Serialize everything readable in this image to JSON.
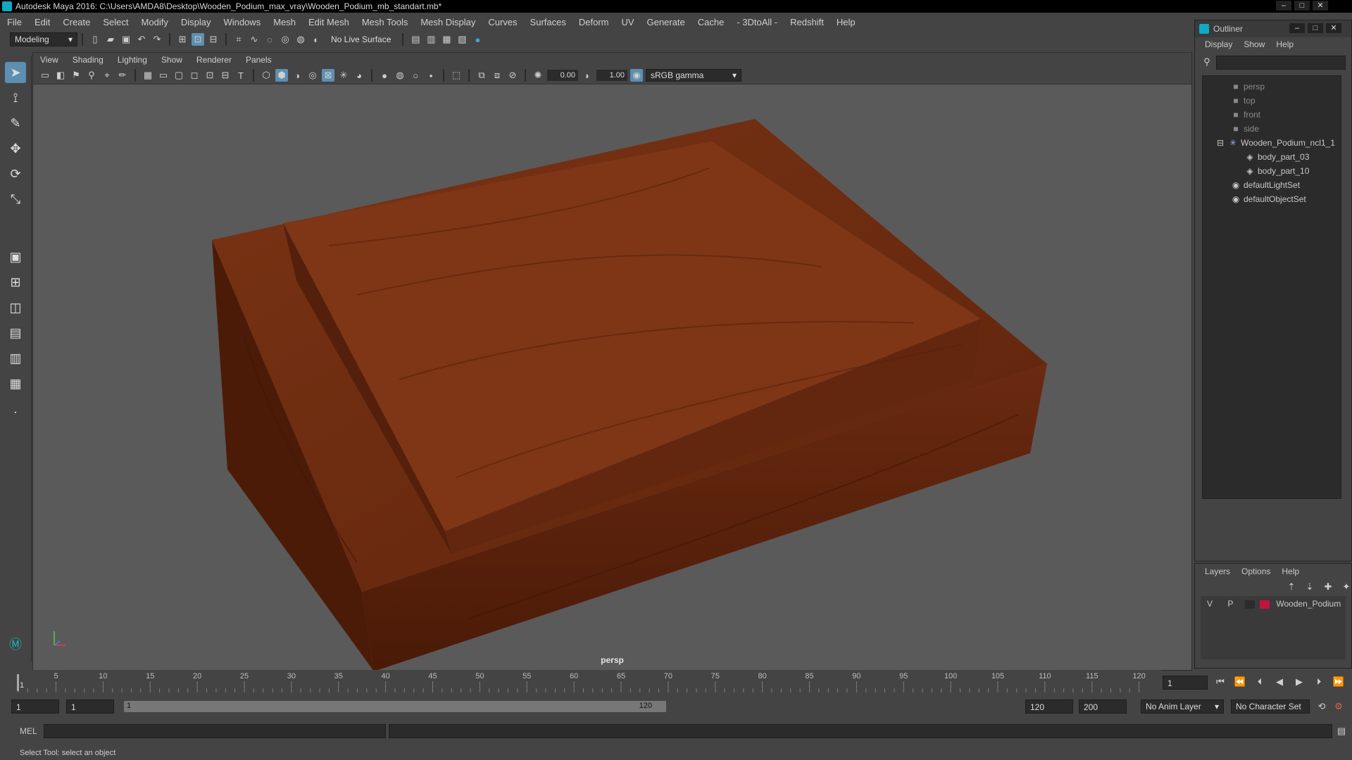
{
  "window": {
    "title": "Autodesk Maya 2016: C:\\Users\\AMDA8\\Desktop\\Wooden_Podium_max_vray\\Wooden_Podium_mb_standart.mb*"
  },
  "menubar": [
    "File",
    "Edit",
    "Create",
    "Select",
    "Modify",
    "Display",
    "Windows",
    "Mesh",
    "Edit Mesh",
    "Mesh Tools",
    "Mesh Display",
    "Curves",
    "Surfaces",
    "Deform",
    "UV",
    "Generate",
    "Cache",
    "- 3DtoAll -",
    "Redshift",
    "Help"
  ],
  "statusline": {
    "mode": "Modeling",
    "live_surface": "No Live Surface"
  },
  "viewport": {
    "menu": [
      "View",
      "Shading",
      "Lighting",
      "Show",
      "Renderer",
      "Panels"
    ],
    "exposure": "0.00",
    "gamma": "1.00",
    "color_space": "sRGB gamma",
    "camera_label": "persp",
    "wood_color": "#6b2a0f"
  },
  "timeslider": {
    "ticks": [
      "5",
      "10",
      "15",
      "20",
      "25",
      "30",
      "35",
      "40",
      "45",
      "50",
      "55",
      "60",
      "65",
      "70",
      "75",
      "80",
      "85",
      "90",
      "95",
      "100",
      "105",
      "110",
      "115",
      "120"
    ],
    "current_marker": "1",
    "current_frame": "1"
  },
  "range": {
    "start": "1",
    "playback_start": "1",
    "slider_start": "1",
    "slider_end": "120",
    "playback_end": "120",
    "end": "200",
    "anim_layer": "No Anim Layer",
    "character_set": "No Character Set"
  },
  "cmdline": {
    "label": "MEL"
  },
  "helpline": {
    "text": "Select Tool: select an object"
  },
  "outliner": {
    "title": "Outliner",
    "menu": [
      "Display",
      "Show",
      "Help"
    ],
    "items": [
      {
        "label": "persp",
        "icon": "camera-icon",
        "indent": 1,
        "dim": true
      },
      {
        "label": "top",
        "icon": "camera-icon",
        "indent": 1,
        "dim": true
      },
      {
        "label": "front",
        "icon": "camera-icon",
        "indent": 1,
        "dim": true
      },
      {
        "label": "side",
        "icon": "camera-icon",
        "indent": 1,
        "dim": true
      },
      {
        "label": "Wooden_Podium_ncl1_1",
        "icon": "group-icon",
        "indent": 1,
        "dim": false
      },
      {
        "label": "body_part_03",
        "icon": "mesh-icon",
        "indent": 2,
        "dim": false
      },
      {
        "label": "body_part_10",
        "icon": "mesh-icon",
        "indent": 2,
        "dim": false
      },
      {
        "label": "defaultLightSet",
        "icon": "set-icon",
        "indent": 1,
        "dim": false
      },
      {
        "label": "defaultObjectSet",
        "icon": "set-icon",
        "indent": 1,
        "dim": false
      }
    ]
  },
  "layers": {
    "menu": [
      "Layers",
      "Options",
      "Help"
    ],
    "row": {
      "v": "V",
      "p": "P",
      "name": "Wooden_Podium",
      "color": "#c0143c"
    }
  }
}
